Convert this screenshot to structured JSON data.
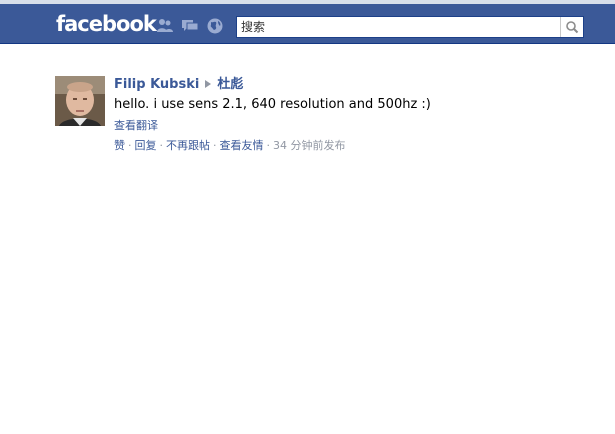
{
  "header": {
    "logo": "facebook",
    "search": {
      "placeholder": "搜索"
    },
    "colors": {
      "bar": "#3b5998",
      "link": "#3b5998",
      "muted": "#9197a3"
    }
  },
  "story": {
    "author": "Filip Kubski",
    "recipient": "杜彪",
    "message": "hello. i use sens 2.1, 640 resolution and 500hz :)",
    "translate_link": "查看翻译",
    "actions": {
      "like": "赞",
      "reply": "回复",
      "unfollow": "不再跟帖",
      "see_friendship": "查看友情",
      "timestamp": "34 分钟前发布"
    }
  },
  "icons": [
    "friend-requests-icon",
    "messages-icon",
    "notifications-globe-icon",
    "search-magnifier-icon"
  ]
}
